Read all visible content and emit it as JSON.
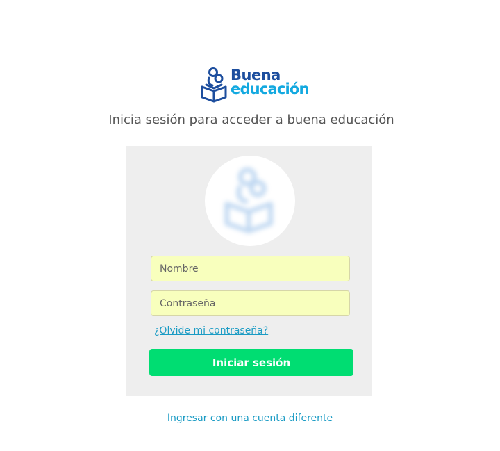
{
  "logo": {
    "line1": "Buena",
    "line2": "educación",
    "primary_color": "#1d4e9e",
    "secondary_color": "#13a9e0",
    "icon": "reading-child-icon"
  },
  "subtitle": "Inicia sesión para acceder a buena educación",
  "login_form": {
    "avatar_icon": "reading-child-icon",
    "username": {
      "placeholder": "Nombre",
      "value": ""
    },
    "password": {
      "placeholder": "Contraseña",
      "value": ""
    },
    "forgot_password_label": "¿Olvide mi contraseña?",
    "submit_label": "Iniciar sesión",
    "submit_color": "#00dd72",
    "field_background": "#f8ffbd"
  },
  "other_account_label": "Ingresar con una cuenta diferente",
  "link_color": "#1a9bc4"
}
